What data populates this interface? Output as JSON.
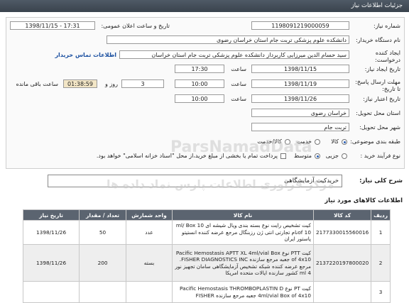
{
  "header": {
    "title": "جزئیات اطلاعات نیاز"
  },
  "form": {
    "need_number_label": "شماره نیاز:",
    "need_number_value": "1198091219000059",
    "announce_label": "تاریخ و ساعت اعلان عمومی:",
    "announce_value": "1398/11/15 - 17:31",
    "buyer_label": "نام دستگاه خریدار:",
    "buyer_value": "دانشکده علوم پزشکی تربت جام استان خراسان رضوی",
    "creator_label": "ایجاد کننده درخواست:",
    "creator_value": "سید حسام الدین میرزایی کاربرداز دانشکده علوم پزشکی تربت جام استان خراسان",
    "contact_link": "اطلاعات تماس خریدار",
    "create_date_label": "تاریخ ایجاد نیاز:",
    "create_date_value": "1398/11/15",
    "time_label": "ساعت",
    "create_time_value": "17:30",
    "deadline_label": "مهلت ارسال پاسخ: تا تاریخ:",
    "deadline_date_value": "1398/11/19",
    "deadline_time_value": "10:00",
    "days_label": "روز و",
    "days_value": "3",
    "remaining_value": "01:38:59",
    "remaining_label": "ساعت باقی مانده",
    "validity_label": "تاریخ اعتبار نیاز:",
    "validity_value": "1398/11/26",
    "validity_time_value": "10:00",
    "province_label": "استان محل تحویل:",
    "province_value": "خراسان رضوی",
    "city_label": "شهر محل تحویل:",
    "city_value": "تربت جام",
    "category_label": "طبقه بندی موضوعی:",
    "category_options": [
      "کالا",
      "خدمت",
      "کالا/خدمت"
    ],
    "category_selected": "کالا",
    "purchase_label": "نوع فرآیند خرید :",
    "purchase_options": [
      "جزیی",
      "متوسط"
    ],
    "purchase_selected": "متوسط",
    "payment_note": "پرداخت تمام یا بخشی از مبلغ خرید،از محل \"اسناد خزانه اسلامی\" خواهد بود."
  },
  "description": {
    "label": "شرح کلی نیاز:",
    "value": "خریدکیت آزمایشگاهی"
  },
  "watermark": {
    "line1": "مرکز فراوری اطلاعات پارس نماد داده ها",
    "line2": "ParsNamadData"
  },
  "goods": {
    "section_title": "اطلاعات کالاهای مورد نیاز",
    "headers": [
      "ردیف",
      "کد کالا",
      "نام کالا",
      "واحد شمارش",
      "تعداد / مقدار",
      "تاریخ نیاز"
    ],
    "rows": [
      {
        "row": "1",
        "code": "2177330015560016",
        "name": "کیت تشخیص رایت نوع بسته بندی ویال شیشه ای 10 ml/ Box of 10نام تجارتی انتی ژن رزبنگال مرجع عرضه کننده انستیتو پاستور ایران",
        "unit": "عدد",
        "qty": "50",
        "date": "1398/11/26"
      },
      {
        "row": "2",
        "code": "2137220197800020",
        "name": "کیت PTT نوع Pacific Hemostasis APTT XL 4ml/vial Box of 4x10 جعبه مرجع سازنده FISHER DIAGNOSTICS INC. مرجع عرضه کننده شبکه تشخیص آزمایشگاهی سامان تجهیز نور 4 ml کشور سازنده ایالات متحده امریکا",
        "unit": "بسته",
        "qty": "200",
        "date": "1398/11/26"
      },
      {
        "row": "3",
        "code": "",
        "name": "کیت PT نوع Pacific Hemostasis THROMBOPLASTIN D 4ml/vial Box of 4x10 جعبه مرجع سازنده FISHER",
        "unit": "",
        "qty": "",
        "date": ""
      }
    ]
  }
}
